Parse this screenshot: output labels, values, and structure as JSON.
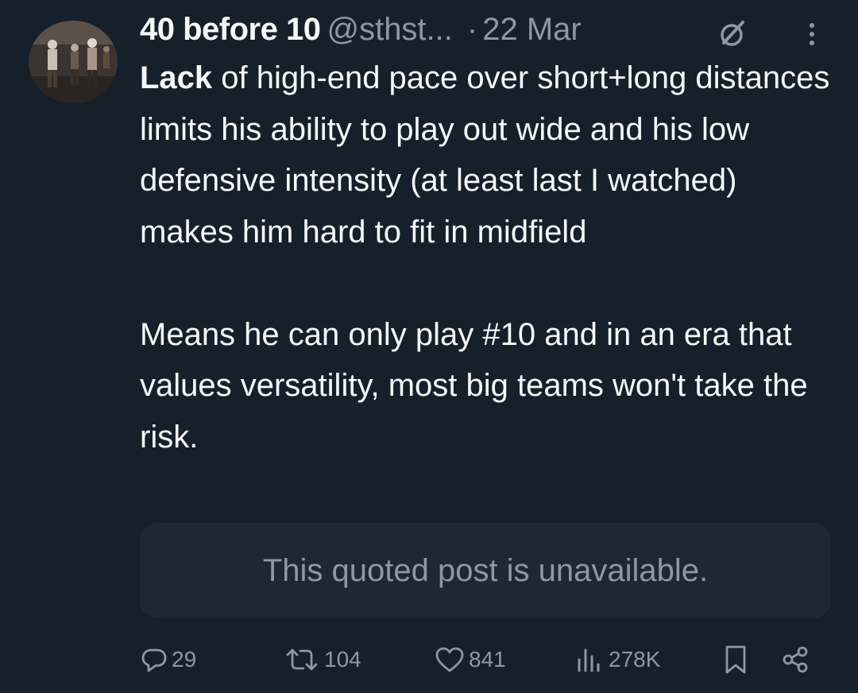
{
  "author": {
    "display_name": "40 before 10",
    "handle": "@sthst...",
    "date": "22 Mar",
    "avatar_icon": "profile-photo"
  },
  "post": {
    "lead": "Lack",
    "paragraph1_rest": " of high-end pace over short+long distances limits his ability to play out wide and his low defensive intensity (at least last I watched) makes him hard to fit in midfield",
    "paragraph2": "Means he can only play #10 and in an era that values versatility, most big teams won't take the risk."
  },
  "quoted_post": {
    "text": "This quoted post is unavailable."
  },
  "actions": {
    "replies": "29",
    "reposts": "104",
    "likes": "841",
    "views": "278K"
  },
  "colors": {
    "background": "#15202b",
    "text": "#f7f9f9",
    "muted": "#8b98a5",
    "quote_background": "#1e2732"
  }
}
